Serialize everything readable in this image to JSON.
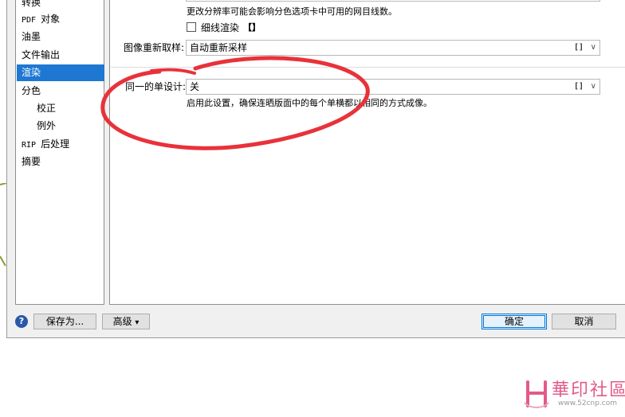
{
  "sidebar": {
    "items": [
      {
        "label": "转换"
      },
      {
        "prefix": "PDF",
        "label": "对象"
      },
      {
        "label": "油墨"
      },
      {
        "label": "文件输出"
      },
      {
        "label": "渲染",
        "selected": true
      },
      {
        "label": "分色"
      },
      {
        "label": "校正",
        "sub": true
      },
      {
        "label": "例外",
        "sub": true
      },
      {
        "prefix": "RIP",
        "label": "后处理"
      },
      {
        "label": "摘要"
      }
    ]
  },
  "content": {
    "resolution_note": "更改分辨率可能会影响分色选项卡中可用的网目线数。",
    "hairline_checkbox": {
      "label": "细线渲染",
      "lock": "【】",
      "checked": false
    },
    "image_resample": {
      "label": "图像重新取样:",
      "value": "自动重新采样",
      "lock": "[]"
    },
    "step_repeat": {
      "label": "同一的单设计:",
      "value": "关",
      "lock": "[]"
    },
    "step_repeat_note": "启用此设置，确保连晒版面中的每个单横都以相同的方式成像。"
  },
  "footer": {
    "help_glyph": "?",
    "save_as_label": "保存为...",
    "advanced_label": "高级",
    "advanced_arrow": "▾",
    "ok_label": "确定",
    "cancel_label": "取消"
  },
  "watermark": {
    "brand": "華印社區",
    "url": "www.52cnp.com"
  },
  "colors": {
    "accent": "#1e78d2",
    "annotation": "#e8323a",
    "watermark": "#e25a8a"
  }
}
